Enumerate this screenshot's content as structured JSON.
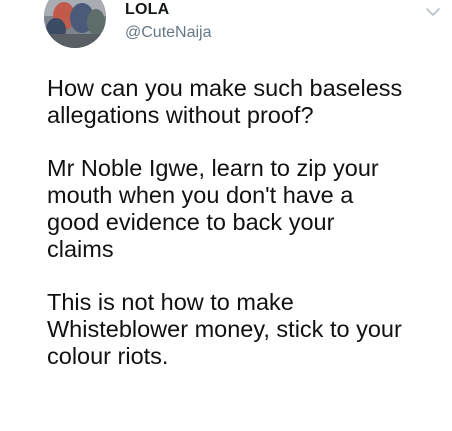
{
  "tweet": {
    "author": {
      "display_name": "LOLA",
      "handle": "@CuteNaija"
    },
    "menu_icon": "chevron-down-icon",
    "avatar_icon": "profile-photo",
    "paragraphs": [
      {
        "lines": [
          "How can you make such baseless",
          "allegations without proof?"
        ]
      },
      {
        "lines": [
          "Mr Noble Igwe, learn to zip your",
          "mouth when you don't have a",
          "good evidence to back your",
          "claims"
        ]
      },
      {
        "lines": [
          "This is not how to make",
          "Whisteblower money, stick to your",
          "colour riots."
        ]
      }
    ]
  },
  "colors": {
    "text": "#111111",
    "handle": "#657786",
    "caret": "#b8c0c8"
  }
}
